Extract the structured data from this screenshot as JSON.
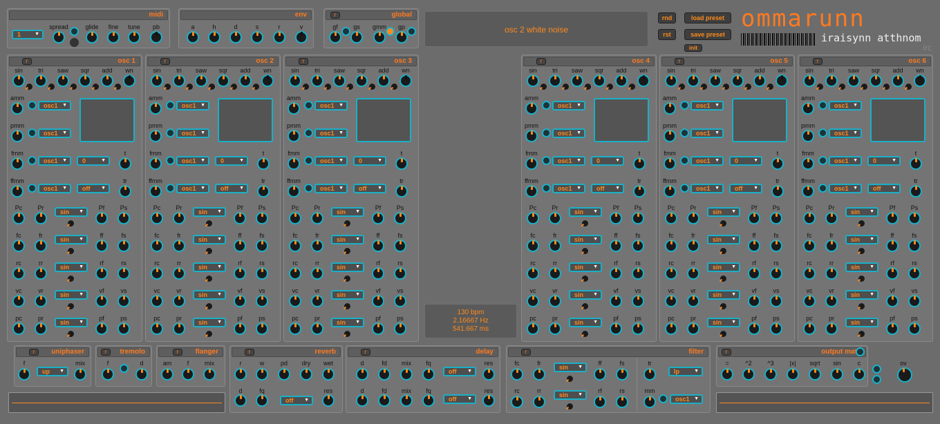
{
  "top": {
    "midi": {
      "title": "midi",
      "channel": "1",
      "labels": [
        "spread",
        "glide",
        "fine",
        "tune",
        "pb"
      ]
    },
    "env": {
      "title": "env",
      "labels": [
        "a",
        "h",
        "d",
        "s",
        "r",
        "v"
      ]
    },
    "global": {
      "title": "global",
      "reset": "r",
      "labels": [
        "gf",
        "gs",
        "gmm",
        "gp"
      ]
    },
    "display": {
      "text": "osc 2 white noise"
    },
    "buttons": {
      "rnd": "rnd",
      "rst": "rst",
      "load": "load preset",
      "save": "save preset",
      "init": "init"
    },
    "logo": {
      "name": "ommarunn",
      "subtitle": "iraisynn atthnom",
      "tag": "irc"
    }
  },
  "osc": {
    "titles": [
      "osc 1",
      "osc 2",
      "osc 3",
      "osc 4",
      "osc 5",
      "osc 6"
    ],
    "reset": "r",
    "wave_labels": [
      "sin",
      "tri",
      "saw",
      "sqr",
      "add",
      "wn"
    ],
    "mod_labels": [
      "amm",
      "pmm",
      "fmm",
      "ffmm"
    ],
    "mod_source": "osc1",
    "fmm_value": "0",
    "ffmm_value": "off",
    "t_label": "t",
    "tr_label": "tr",
    "rows": [
      {
        "l1": "Pc",
        "l2": "Pr",
        "l3": "Pf",
        "l4": "Ps",
        "shape": "sin"
      },
      {
        "l1": "fc",
        "l2": "fr",
        "l3": "ff",
        "l4": "fs",
        "shape": "sin"
      },
      {
        "l1": "rc",
        "l2": "rr",
        "l3": "rf",
        "l4": "rs",
        "shape": "sin"
      },
      {
        "l1": "vc",
        "l2": "vr",
        "l3": "vf",
        "l4": "vs",
        "shape": "sin"
      },
      {
        "l1": "pc",
        "l2": "pr",
        "l3": "pf",
        "l4": "ps",
        "shape": "sin"
      }
    ]
  },
  "tempo": {
    "bpm": "130 bpm",
    "hz": "2.16667 Hz",
    "ms": "541.667 ms"
  },
  "fx": {
    "uniphaser": {
      "title": "uniphaser",
      "reset": "r",
      "f": "f",
      "mix": "mix",
      "mode": "up"
    },
    "tremolo": {
      "title": "tremolo",
      "reset": "r",
      "f": "f",
      "d": "d"
    },
    "flanger": {
      "title": "flanger",
      "reset": "r",
      "labels": [
        "am",
        "f",
        "mix"
      ]
    },
    "reverb": {
      "title": "reverb",
      "reset": "r",
      "labels": [
        "r",
        "w",
        "pd",
        "dry",
        "wet"
      ],
      "labels2": [
        "d",
        "fq",
        "res"
      ],
      "mode": "off"
    },
    "delay": {
      "title": "delay",
      "reset": "r",
      "labels": [
        "d",
        "fd",
        "mix",
        "fq",
        "res"
      ],
      "mode1": "off",
      "mode2": "off"
    },
    "filter": {
      "title": "filter",
      "reset": "r",
      "labels": [
        "fc",
        "fr",
        "ff",
        "fs"
      ],
      "labels2": [
        "rc",
        "rr",
        "rf",
        "rs"
      ],
      "shape1": "sin",
      "shape2": "sin",
      "tr": "tr",
      "mm": "mm",
      "type": "lp",
      "src": "osc1"
    },
    "output": {
      "title": "output math",
      "reset": "r",
      "labels": [
        "=",
        "^2",
        "^3",
        "|x|",
        "sqrt",
        "sin"
      ],
      "c": "c",
      "ov": "ov"
    }
  },
  "colors": {
    "accent": "#ff7a20",
    "cyan": "#1ab0c8",
    "panel": "#747474",
    "bg": "#6c6c6c"
  }
}
